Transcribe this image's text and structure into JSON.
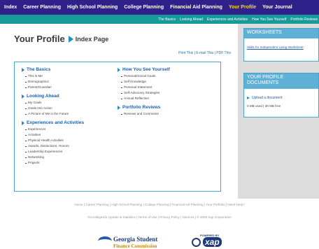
{
  "topnav": {
    "items": [
      "Index",
      "Career Planning",
      "High School Planning",
      "College Planning",
      "Financial Aid Planning",
      "Your Profile",
      "Your Journal"
    ],
    "active_index": 5
  },
  "subnav": {
    "items": [
      "The Basics",
      "Looking Ahead",
      "Experiences and Activities",
      "How You See Yourself",
      "Portfolio Reviews"
    ]
  },
  "page": {
    "title": "Your Profile",
    "subtitle": "Index Page",
    "print_links": "Print This | E-mail This | PDF This"
  },
  "sections_left": [
    {
      "heading": "The Basics",
      "items": [
        "This is Me",
        "Demographics",
        "Parent/Guardian"
      ]
    },
    {
      "heading": "Looking Ahead",
      "items": [
        "My Goals",
        "Goals Into Action",
        "A Picture of Me in the Future"
      ]
    },
    {
      "heading": "Experiences and Activities",
      "items": [
        "Experiences",
        "Activities",
        "Physical Health Activities",
        "Awards, Distinctions, Honors",
        "Leadership Experiences",
        "Networking",
        "Projects"
      ]
    }
  ],
  "sections_right": [
    {
      "heading": "How You See Yourself",
      "items": [
        "Personal/Social Goals",
        "Self Knowledge",
        "Personal Statement",
        "Self-Advocacy Strategies",
        "Annual Reflection"
      ]
    },
    {
      "heading": "Portfolio Reviews",
      "items": [
        "Reviews and Comments"
      ]
    }
  ],
  "sidebar": {
    "worksheets": {
      "title": "WORKSHEETS",
      "link": "Skills for Independent Living Worksheet"
    },
    "documents": {
      "title": "YOUR PROFILE DOCUMENTS",
      "upload": "Upload a document",
      "quota": "0 MB used | 30 MB free"
    }
  },
  "footer": {
    "line1": "Home | Career Planning | High School Planning | College Planning | Financial Aid Planning | Your Portfolio | Need Help?",
    "line2": "GAcollege411 Update & Statistics | Terms of Use | Privacy Policy | Sources | © 2009 Xap Corporation"
  },
  "logos": {
    "gsfc_line1": "Georgia Student",
    "gsfc_line2": "Finance Commission",
    "sap_powered": "POWERED BY",
    "sap_word": "xap"
  },
  "colors": {
    "topnav_bg": "#30208a",
    "subnav_bg": "#169b9a",
    "active_nav": "#f6d72c",
    "link_blue": "#1e5da8",
    "accent_arrow": "#1d8fc2"
  }
}
